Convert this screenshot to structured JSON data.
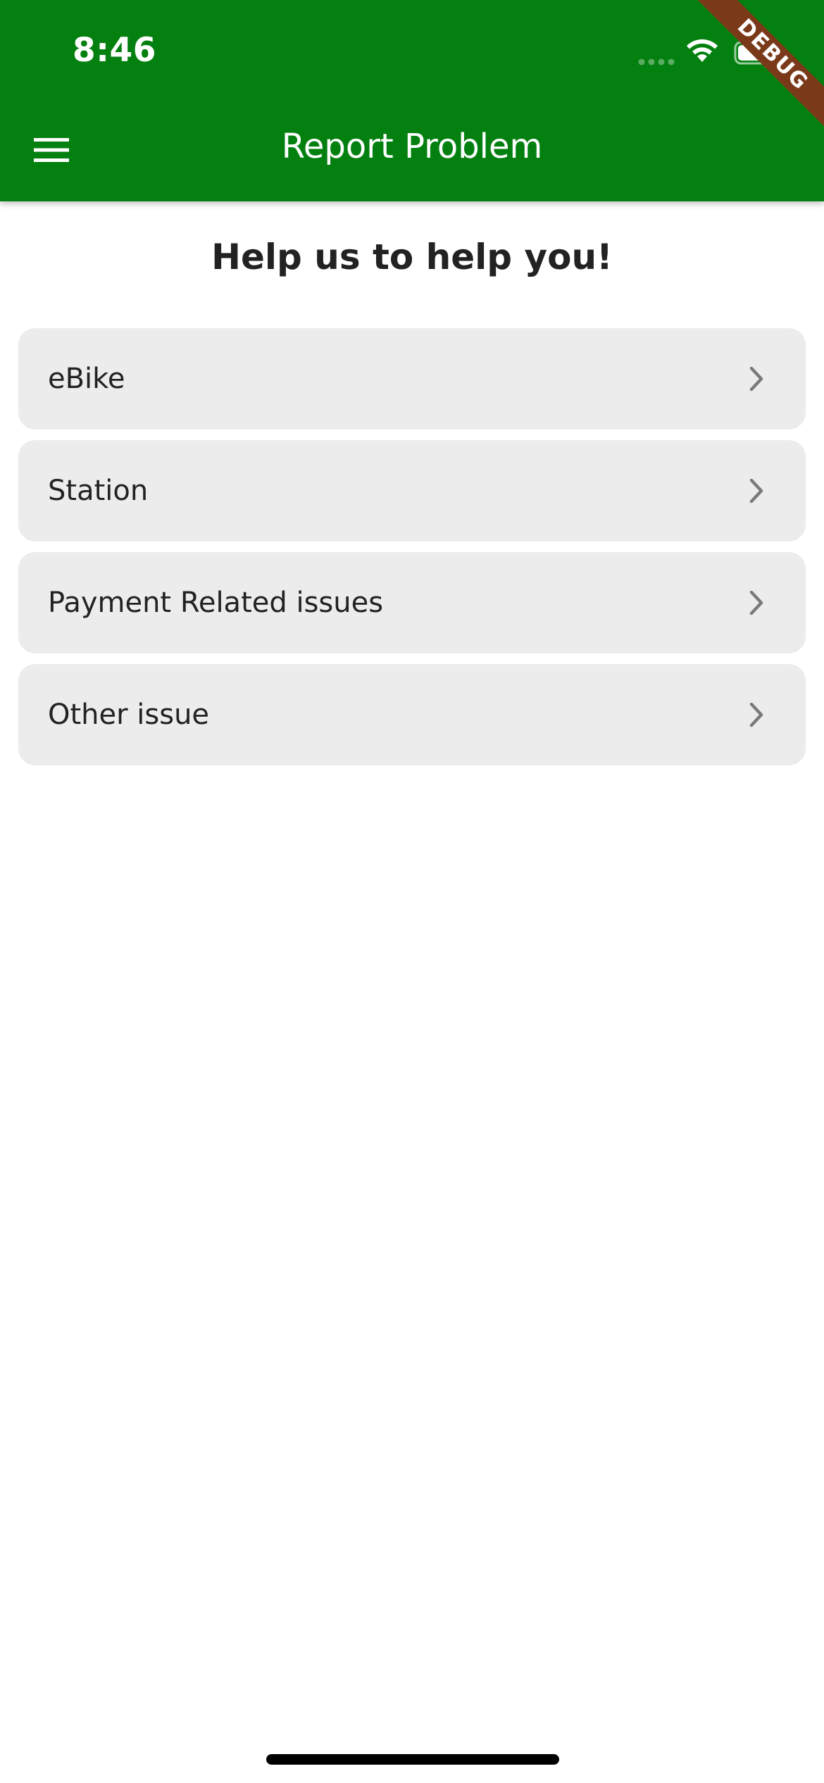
{
  "colors": {
    "app_bar": "#03800f",
    "app_bar_text": "#ffffff",
    "debug_ribbon": "#7a3a1a",
    "heading_text": "#222222",
    "list_item_bg": "#ececec",
    "list_item_text": "#222222",
    "chevron": "#7a7a7a",
    "home_indicator": "#000000",
    "page_bg": "#ffffff"
  },
  "status_bar": {
    "time": "8:46",
    "signal_icon": "cellular-signal-icon",
    "wifi_icon": "wifi-icon",
    "battery_icon": "battery-icon"
  },
  "debug_banner": {
    "label": "DEBUG"
  },
  "app_bar": {
    "title": "Report Problem",
    "menu_icon": "hamburger-menu-icon"
  },
  "page": {
    "heading": "Help us to help you!"
  },
  "categories": [
    {
      "label": "eBike",
      "icon": "chevron-right-icon"
    },
    {
      "label": "Station",
      "icon": "chevron-right-icon"
    },
    {
      "label": "Payment Related issues",
      "icon": "chevron-right-icon"
    },
    {
      "label": "Other issue",
      "icon": "chevron-right-icon"
    }
  ]
}
